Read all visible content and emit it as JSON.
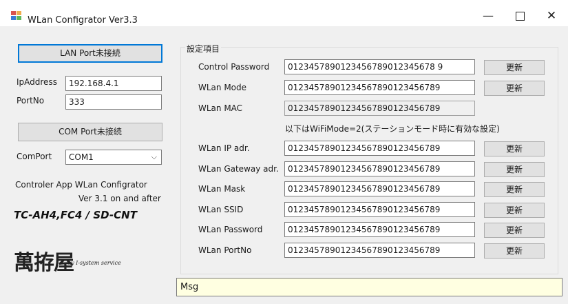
{
  "window": {
    "title": "WLan Configrator Ver3.3",
    "minimize_glyph": "—",
    "close_glyph": "✕"
  },
  "left_panel": {
    "lan_port_button": "LAN Port未接続",
    "ipaddress_label": "IpAddress",
    "ipaddress_value": "192.168.4.1",
    "portno_label": "PortNo",
    "portno_value": "333",
    "com_port_button": "COM Port未接続",
    "comport_label": "ComPort",
    "comport_value": "COM1",
    "info_line1": "Controler App WLan Configrator",
    "info_line2": "Ver 3.1 on and after",
    "model_text": "TC-AH4,FC4 / SD-CNT",
    "brand_text": "萬拵屋",
    "brand_sub": "by I-system service"
  },
  "settings": {
    "group_title": "設定項目",
    "note": "以下はWiFiMode=2(ステーションモード時に有効な設定)",
    "rows": [
      {
        "label": "Control Password",
        "value": "0123457890123456789012345678 9",
        "button": "更新"
      },
      {
        "label": "WLan Mode",
        "value": "01234578901234567890123456789",
        "button": "更新"
      },
      {
        "label": "WLan MAC",
        "value": "01234578901234567890123456789"
      },
      {
        "label": "WLan IP adr.",
        "value": "01234578901234567890123456789",
        "button": "更新"
      },
      {
        "label": "WLan Gateway adr.",
        "value": "01234578901234567890123456789",
        "button": "更新"
      },
      {
        "label": "WLan Mask",
        "value": "01234578901234567890123456789",
        "button": "更新"
      },
      {
        "label": "WLan SSID",
        "value": "01234578901234567890123456789",
        "button": "更新"
      },
      {
        "label": "WLan Password",
        "value": "01234578901234567890123456789",
        "button": "更新"
      },
      {
        "label": "WLan PortNo",
        "value": "01234578901234567890123456789",
        "button": "更新"
      }
    ]
  },
  "message": {
    "value": "Msg"
  },
  "colors": {
    "client_bg": "#f0f0f0",
    "msg_bg": "#ffffe1",
    "focus_border": "#0078d7"
  }
}
